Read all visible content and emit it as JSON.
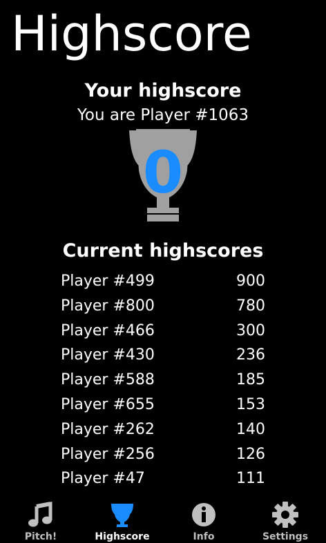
{
  "page": {
    "title": "Highscore"
  },
  "your_highscore": {
    "heading": "Your highscore",
    "player_line": "You are Player #1063",
    "score": "0"
  },
  "current_highscores": {
    "heading": "Current highscores",
    "rows": [
      {
        "player": "Player #499",
        "score": "900"
      },
      {
        "player": "Player #800",
        "score": "780"
      },
      {
        "player": "Player #466",
        "score": "300"
      },
      {
        "player": "Player #430",
        "score": "236"
      },
      {
        "player": "Player #588",
        "score": "185"
      },
      {
        "player": "Player #655",
        "score": "153"
      },
      {
        "player": "Player #262",
        "score": "140"
      },
      {
        "player": "Player #256",
        "score": "126"
      },
      {
        "player": "Player #47",
        "score": "111"
      }
    ]
  },
  "tabs": [
    {
      "label": "Pitch!",
      "icon": "music-note-icon"
    },
    {
      "label": "Highscore",
      "icon": "trophy-icon",
      "active": true
    },
    {
      "label": "Info",
      "icon": "info-icon"
    },
    {
      "label": "Settings",
      "icon": "gear-icon"
    }
  ],
  "colors": {
    "accent": "#1a8cff",
    "background": "#000000",
    "trophy": "#a0a0a0",
    "inactive_tab": "#c0c0c0"
  }
}
